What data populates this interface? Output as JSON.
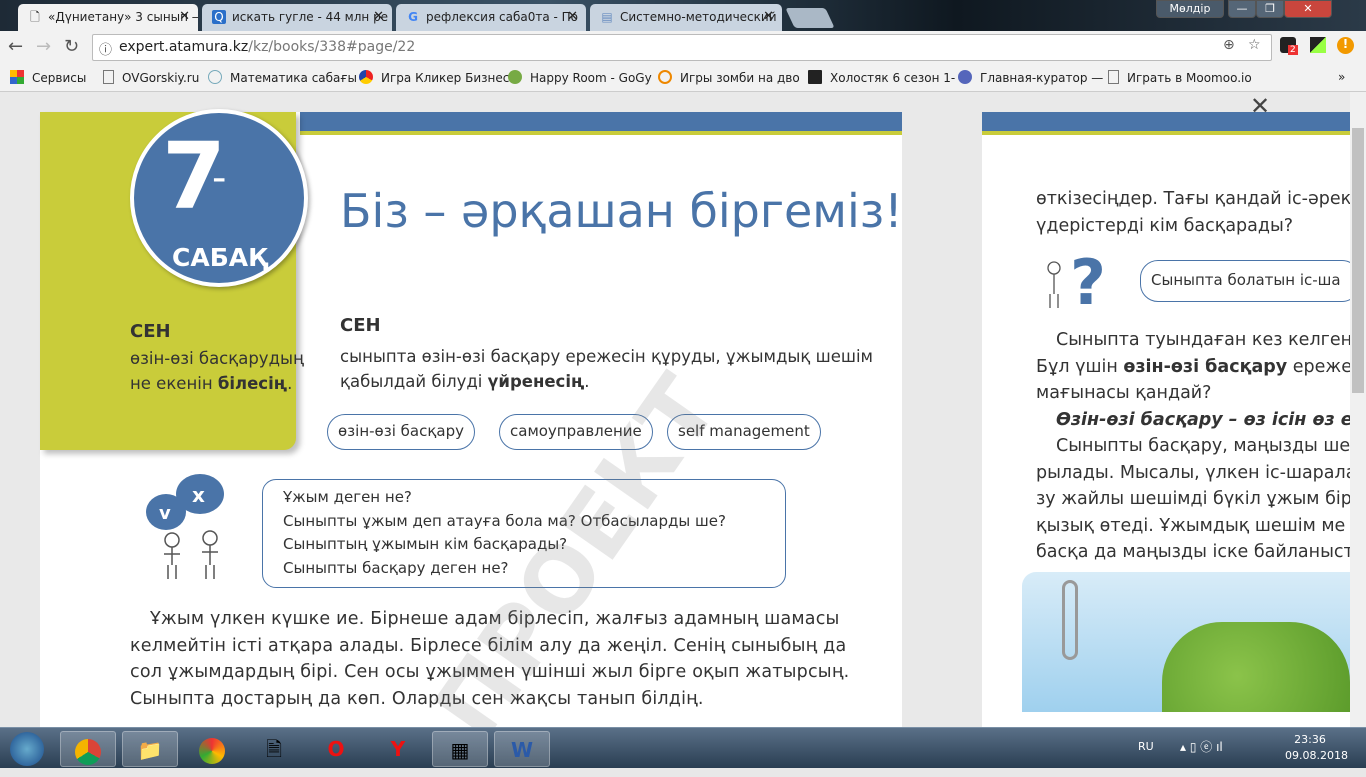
{
  "browser": {
    "tabs": [
      {
        "title": "«Дүниетану» 3 сынып —",
        "icon": "page-icon",
        "active": true
      },
      {
        "title": "искать гугле - 44 млн ре",
        "icon": "search-icon"
      },
      {
        "title": "рефлексия саба0та - По",
        "icon": "google-icon"
      },
      {
        "title": "Системно-методический",
        "icon": "doc-icon"
      }
    ],
    "user_badge": "Мөлдір",
    "url_host": "expert.atamura.kz",
    "url_path": "/kz/books/338#page/22",
    "extension_badge": "2",
    "bookmarks": [
      "Сервисы",
      "OVGorskiy.ru",
      "Математика сабағы",
      "Игра Кликер Бизнес",
      "Happy Room - GoGy",
      "Игры зомби на дво",
      "Холостяк 6 сезон 1-",
      "Главная-куратор —",
      "Играть в Moomoo.io"
    ],
    "bookmarks_more": "»"
  },
  "book": {
    "close": "✕",
    "lesson_number": "7",
    "lesson_dash": "-",
    "lesson_word": "САБАҚ",
    "title": "Біз – әрқашан біргеміз!",
    "left_goal": {
      "heading": "СЕН",
      "text": "өзін-өзі басқарудың",
      "text2": "не екенін ",
      "bold": "білесің",
      "end": "."
    },
    "right_goal": {
      "heading": "СЕН",
      "text": "сыныпта өзін-өзі басқару ережесін құруды, ұжымдық шешім",
      "text2": "қабылдай білуді ",
      "bold": "үйренесің",
      "end": "."
    },
    "terms": [
      "өзін-өзі басқару",
      "самоуправление",
      "self management"
    ],
    "questions": [
      "Ұжым деген не?",
      "Сыныпты ұжым деп атауға бола ма? Отбасыларды ше?",
      "Сыныптың ұжымын кім басқарады?",
      "Сыныпты басқару деген не?"
    ],
    "paragraph": [
      "Ұжым үлкен күшке ие. Бірнеше адам бірлесіп, жалғыз адамның шамасы",
      "келмейтін істі атқара алады. Бірлесе білім алу да жеңіл. Сенің сыныбың да",
      "сол ұжымдардың бірі. Сен осы ұжыммен үшінші жыл бірге оқып жатырсың.",
      "Сыныпта достарың да көп. Оларды сен жақсы танып білдің."
    ],
    "watermark": "ПРОЕКТ",
    "right_page": {
      "lines_top": [
        "өткізесіңдер. Тағы қандай іс-әрек",
        "үдерістерді кім басқарады?"
      ],
      "pill": "Сыныпта болатын іс-ша",
      "line1": "Сыныпта туындаған кез келген",
      "line2a": "Бұл үшін ",
      "line2b": "өзін-өзі басқару",
      "line2c": " ережес",
      "line3": "мағынасы қандай?",
      "definition": "Өзін-өзі басқару – өз ісін өз е",
      "lines_bottom": [
        "Сыныпты басқару, маңызды ше",
        "рылады. Мысалы, үлкен іс-шарала",
        "зу жайлы шешімді бүкіл ұжым бір",
        "қызық өтеді. Ұжымдық шешім ме",
        "басқа да маңызды іске байланыст"
      ]
    }
  },
  "taskbar": {
    "lang": "RU",
    "time": "23:36",
    "date": "09.08.2018"
  }
}
